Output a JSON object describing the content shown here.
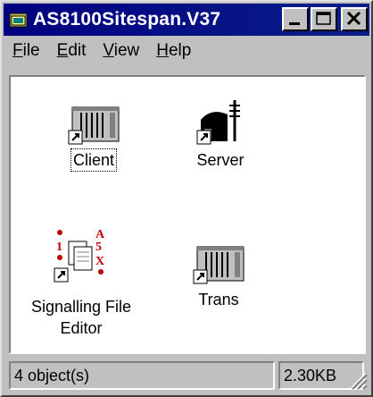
{
  "window": {
    "title": "AS8100Sitespan.V37"
  },
  "menu": [
    {
      "label": "File",
      "accel": "F",
      "rest": "ile"
    },
    {
      "label": "Edit",
      "accel": "E",
      "rest": "dit"
    },
    {
      "label": "View",
      "accel": "V",
      "rest": "iew"
    },
    {
      "label": "Help",
      "accel": "H",
      "rest": "elp"
    }
  ],
  "icons": [
    {
      "label": "Client",
      "kind": "rack-shortcut-icon",
      "focused": true
    },
    {
      "label": "Server",
      "kind": "server-building-shortcut-icon"
    },
    {
      "label_line1": "Signalling File",
      "label_line2": "Editor",
      "kind": "signalling-file-editor-icon"
    },
    {
      "label": "Trans",
      "kind": "rack-shortcut-icon"
    }
  ],
  "status": {
    "objects": "4 object(s)",
    "size": "2.30KB"
  }
}
